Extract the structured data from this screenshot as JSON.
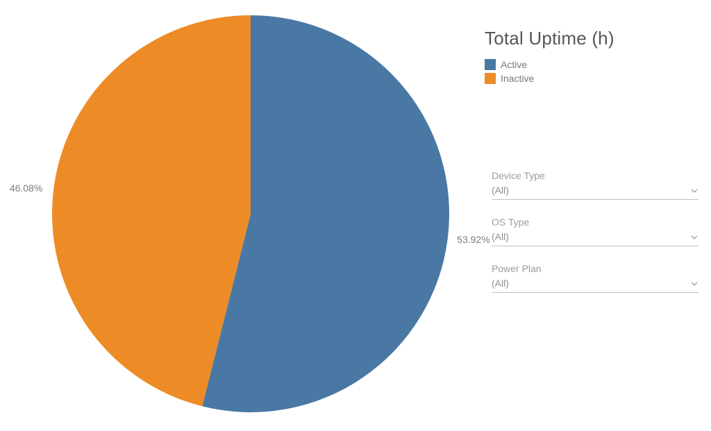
{
  "chart_data": {
    "type": "pie",
    "title": "Total Uptime (h)",
    "series": [
      {
        "name": "Active",
        "value": 53.92,
        "label": "53.92%",
        "color": "#4a78a4"
      },
      {
        "name": "Inactive",
        "value": 46.08,
        "label": "46.08%",
        "color": "#ed8c27"
      }
    ]
  },
  "legend": {
    "items": [
      {
        "label": "Active"
      },
      {
        "label": "Inactive"
      }
    ]
  },
  "filters": [
    {
      "label": "Device Type",
      "value": "(All)"
    },
    {
      "label": "OS Type",
      "value": "(All)"
    },
    {
      "label": "Power Plan",
      "value": "(All)"
    }
  ]
}
